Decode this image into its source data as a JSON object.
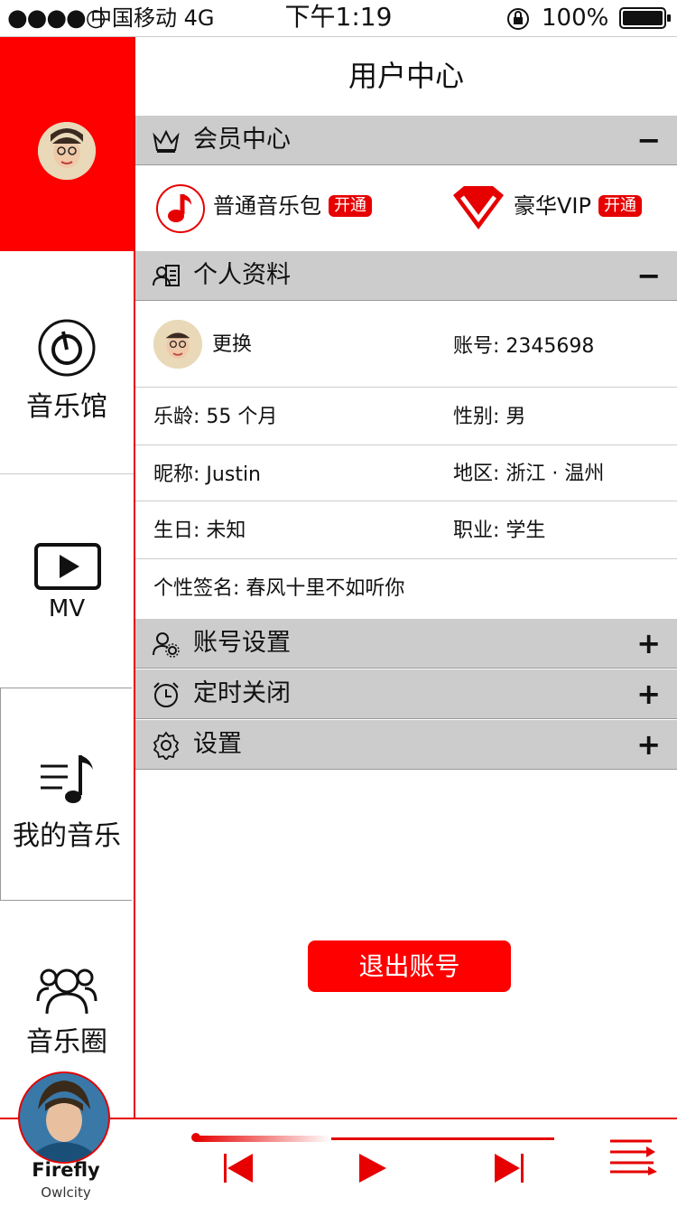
{
  "status_bar": {
    "signal": "●●●●○",
    "carrier": "中国移动",
    "network": "4G",
    "time": "下午1:19",
    "battery": "100%"
  },
  "sidebar": {
    "items": [
      {
        "label": "音乐馆",
        "icon": "disc-icon"
      },
      {
        "label": "MV",
        "icon": "play-screen-icon"
      },
      {
        "label": "我的音乐",
        "icon": "music-list-icon"
      },
      {
        "label": "音乐圈",
        "icon": "group-icon"
      }
    ]
  },
  "header": {
    "title": "用户中心"
  },
  "member": {
    "heading": "会员中心",
    "toggle": "−",
    "normal_pack": "普通音乐包",
    "normal_badge": "开通",
    "vip": "豪华VIP",
    "vip_badge": "开通"
  },
  "profile": {
    "heading": "个人资料",
    "toggle": "−",
    "change_avatar": "更换",
    "account_label": "账号:",
    "account_value": "2345698",
    "age_label": "乐龄:",
    "age_value": "55 个月",
    "gender_label": "性别:",
    "gender_value": "男",
    "nickname_label": "昵称:",
    "nickname_value": "Justin",
    "region_label": "地区:",
    "region_value": "浙江 · 温州",
    "birthday_label": "生日:",
    "birthday_value": "未知",
    "job_label": "职业:",
    "job_value": "学生",
    "signature_label": "个性签名:",
    "signature_value": "春风十里不如听你"
  },
  "sections": [
    {
      "label": "账号设置",
      "toggle": "+"
    },
    {
      "label": "定时关闭",
      "toggle": "+"
    },
    {
      "label": "设置",
      "toggle": "+"
    }
  ],
  "logout_label": "退出账号",
  "player": {
    "song": "Firefly",
    "artist": "Owlcity",
    "progress": 0.38
  },
  "colors": {
    "accent": "#ff0000",
    "section_bg": "#cccccc"
  }
}
